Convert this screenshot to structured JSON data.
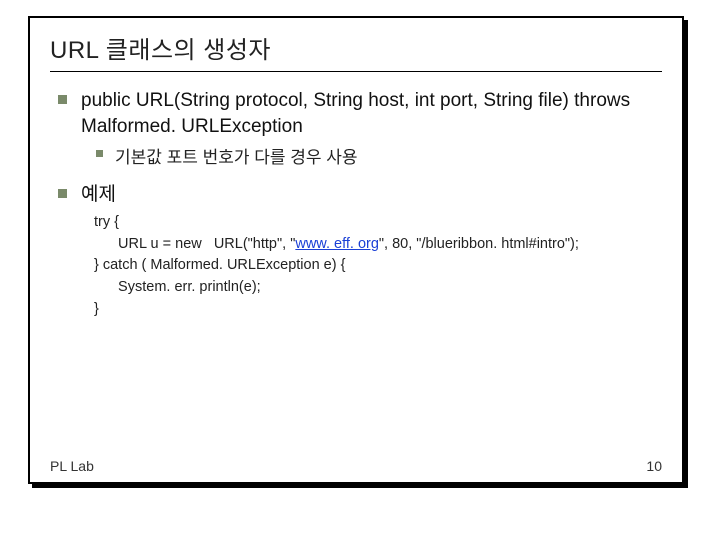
{
  "title": "URL 클래스의 생성자",
  "bullets": {
    "sig": "public URL(String protocol, String host, int port, String file) throws Malformed. URLException",
    "sub": "기본값 포트 번호가 다를 경우 사용",
    "ex": "예제"
  },
  "code": {
    "l1": "try {",
    "l2a": "  URL u = new   URL(\"http\", \"",
    "l2link": "www. eff. org",
    "l2b": "\", 80, \"/blueribbon. html#intro\");",
    "l3": "} catch ( Malformed. URLException e) {",
    "l4": "  System. err. println(e);",
    "l5": "}"
  },
  "footer": {
    "left": "PL Lab",
    "right": "10"
  }
}
